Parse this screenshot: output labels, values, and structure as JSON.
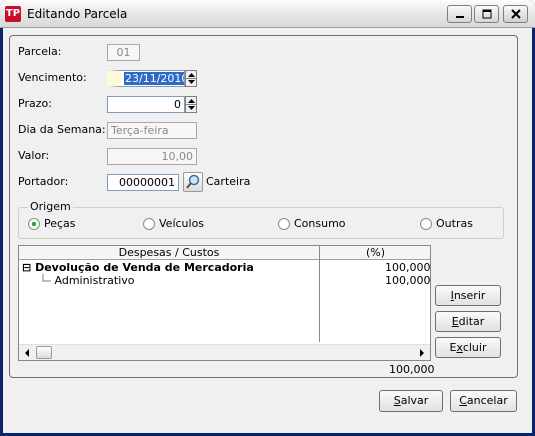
{
  "window": {
    "title": "Editando Parcela",
    "app_icon_glyph": "TP"
  },
  "form": {
    "parcela_label": "Parcela:",
    "parcela_value": "01",
    "vencimento_label": "Vencimento:",
    "vencimento_value": "23/11/2010",
    "prazo_label": "Prazo:",
    "prazo_value": "0",
    "dia_semana_label": "Dia da Semana:",
    "dia_semana_value": "Terça-feira",
    "valor_label": "Valor:",
    "valor_value": "10,00",
    "portador_label": "Portador:",
    "portador_value": "00000001",
    "portador_name": "Carteira"
  },
  "origem": {
    "title": "Origem",
    "options": [
      {
        "label": "Peças",
        "selected": true
      },
      {
        "label": "Veículos",
        "selected": false
      },
      {
        "label": "Consumo",
        "selected": false
      },
      {
        "label": "Outras",
        "selected": false
      }
    ]
  },
  "grid": {
    "col1_header": "Despesas / Custos",
    "col2_header": "(%)",
    "rows": [
      {
        "label": "Devolução de Venda de Mercadoria",
        "value": "100,000",
        "bold": true,
        "expander": "⊟"
      },
      {
        "label": "Administrativo",
        "value": "100,000",
        "bold": false
      }
    ],
    "total": "100,000"
  },
  "side_buttons": {
    "inserir": {
      "pre": "",
      "key": "I",
      "post": "nserir"
    },
    "editar": {
      "pre": "",
      "key": "E",
      "post": "ditar"
    },
    "excluir": {
      "pre": "E",
      "key": "x",
      "post": "cluir"
    }
  },
  "footer": {
    "salvar": {
      "pre": "",
      "key": "S",
      "post": "alvar"
    },
    "cancelar": {
      "pre": "",
      "key": "C",
      "post": "ancelar"
    }
  }
}
